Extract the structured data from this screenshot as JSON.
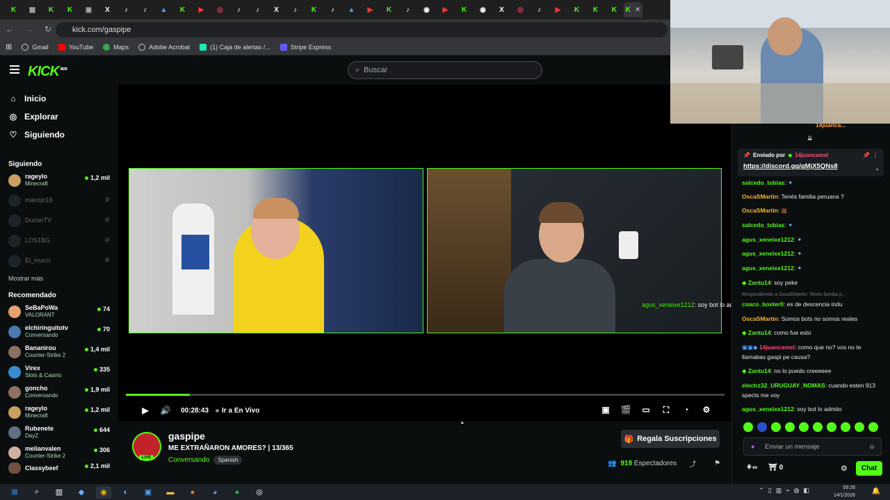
{
  "browser": {
    "url": "kick.com/gaspipe",
    "bookmarks": [
      "Gmail",
      "YouTube",
      "Maps",
      "Adobe Acrobat",
      "(1) Caja de alertas /...",
      "Stripe Express"
    ]
  },
  "header": {
    "logo": "KICK",
    "logo_badge": "BETA",
    "search_placeholder": "Buscar"
  },
  "nav": {
    "items": [
      "Inicio",
      "Explorar",
      "Siguiendo"
    ]
  },
  "following": {
    "title": "Siguiendo",
    "channels": [
      {
        "name": "rageylo",
        "category": "Minecraft",
        "viewers": "1,2 mil",
        "live": true
      },
      {
        "name": "manojo16",
        "live": false
      },
      {
        "name": "DuxterTV",
        "live": false
      },
      {
        "name": "LOS1BG",
        "live": false
      },
      {
        "name": "El_mucci",
        "live": false
      }
    ],
    "show_more": "Mostrar más"
  },
  "recommended": {
    "title": "Recomendado",
    "channels": [
      {
        "name": "SeBaPoWa",
        "category": "VALORANT",
        "viewers": "74"
      },
      {
        "name": "elchiringuitotv",
        "category": "Conversando",
        "viewers": "70"
      },
      {
        "name": "Bananirou",
        "category": "Counter-Strike 2",
        "viewers": "1,4 mil"
      },
      {
        "name": "Virex",
        "category": "Slots & Casino",
        "viewers": "335"
      },
      {
        "name": "goncho",
        "category": "Conversando",
        "viewers": "1,9 mil"
      },
      {
        "name": "rageylo",
        "category": "Minecraft",
        "viewers": "1,2 mil"
      },
      {
        "name": "Rubenete",
        "category": "DayZ",
        "viewers": "644"
      },
      {
        "name": "melianvalen",
        "category": "Counter-Strike 2",
        "viewers": "306"
      },
      {
        "name": "Classybeef",
        "category": "",
        "viewers": "2,1 mil"
      }
    ]
  },
  "player": {
    "time": "00:28:43",
    "live_label": "Ir a En Vivo",
    "progress": 0.107,
    "overlay_user": "agus_xeneixe1212",
    "overlay_text": ": soy bot lo admito"
  },
  "stream": {
    "name": "gaspipe",
    "title": "ME EXTRAÑARON AMORES? | 13/365",
    "category": "Conversando",
    "tag": "Spanish",
    "live_badge": "LIVE",
    "subscribe_label": "Regala Suscripciones",
    "viewers": "918",
    "viewers_label": "Espectadores"
  },
  "chat": {
    "pinned_by": "Enviado por",
    "pinned_user": "14juancamel",
    "pinned_link": "https://discord.gg/gMjX5QNs8",
    "top_user": "14juanca...",
    "messages": [
      {
        "user": "salcedo_tobias",
        "text": "",
        "color": "#53fc18"
      },
      {
        "user": "OscaSMartin",
        "text": "Tenés familia peruana ?",
        "color": "#53fc18"
      },
      {
        "user": "OscaSMartin",
        "text": "",
        "color": "#53fc18"
      },
      {
        "user": "salcedo_tobias",
        "text": "",
        "color": "#53fc18"
      },
      {
        "user": "agus_xeneixe1212",
        "text": "",
        "color": "#53fc18"
      },
      {
        "user": "agus_xeneixe1212",
        "text": "",
        "color": "#53fc18"
      },
      {
        "user": "agus_xeneixe1212",
        "text": "",
        "color": "#53fc18"
      },
      {
        "user": "Zantu14",
        "text": "soy peke",
        "color": "#53fc18"
      },
      {
        "user": "Respondiendo a OscaSMartin: Tenés familia p...",
        "text": "",
        "color": "#777"
      },
      {
        "user": "coaco_boster0",
        "text": "es de descencia indu",
        "color": "#53fc18"
      },
      {
        "user": "OscaSMartin",
        "text": "Somos bots no somos reales",
        "color": "#53fc18"
      },
      {
        "user": "Zantu14",
        "text": "como fue esto",
        "color": "#53fc18"
      },
      {
        "user": "14juancamel",
        "text": "como que no? vos no te llamabas gaspi pe causa?",
        "color": "#ff4d6d"
      },
      {
        "user": "Zantu14",
        "text": "no lo puedo creeeeee",
        "color": "#53fc18"
      },
      {
        "user": "electrz32_URUGUAY_NOMAS",
        "text": "cuando esten 913 spects me voy",
        "color": "#53fc18"
      },
      {
        "user": "agus_xeneixe1212",
        "text": "soy bot lo admito",
        "color": "#53fc18"
      }
    ],
    "input_placeholder": "Enviar un mensaje",
    "points": "0",
    "send_label": "Chat"
  },
  "taskbar": {
    "time": "09:26",
    "date": "14/1/2026"
  },
  "colors": {
    "accent": "#53fc18",
    "bg": "#0b0e0f"
  }
}
